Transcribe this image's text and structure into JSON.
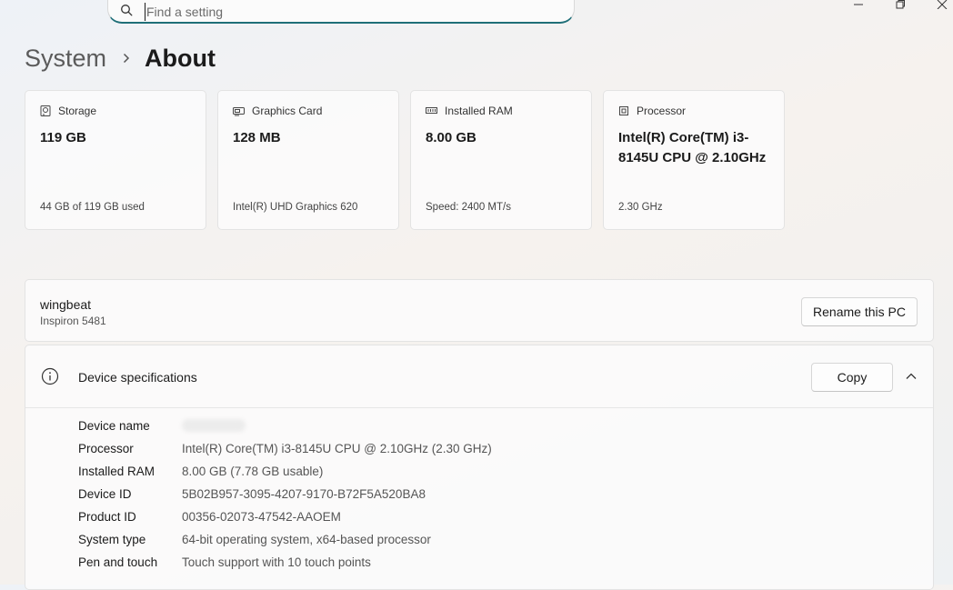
{
  "search": {
    "placeholder": "Find a setting"
  },
  "breadcrumb": {
    "parent": "System",
    "current": "About"
  },
  "cards": [
    {
      "title": "Storage",
      "value": "119 GB",
      "sub": "44 GB of 119 GB used",
      "icon": "storage-icon"
    },
    {
      "title": "Graphics Card",
      "value": "128 MB",
      "sub": "Intel(R) UHD Graphics 620",
      "icon": "graphics-card-icon"
    },
    {
      "title": "Installed RAM",
      "value": "8.00 GB",
      "sub": "Speed: 2400 MT/s",
      "icon": "ram-icon"
    },
    {
      "title": "Processor",
      "value": "Intel(R) Core(TM) i3-8145U CPU @ 2.10GHz",
      "sub": "2.30 GHz",
      "icon": "processor-icon"
    }
  ],
  "pc": {
    "name": "wingbeat",
    "model": "Inspiron 5481",
    "rename_label": "Rename this PC"
  },
  "device_specs": {
    "title": "Device specifications",
    "copy_label": "Copy",
    "rows": [
      {
        "label": "Device name",
        "value": ""
      },
      {
        "label": "Processor",
        "value": "Intel(R) Core(TM) i3-8145U CPU @ 2.10GHz (2.30 GHz)"
      },
      {
        "label": "Installed RAM",
        "value": "8.00 GB (7.78 GB usable)"
      },
      {
        "label": "Device ID",
        "value": "5B02B957-3095-4207-9170-B72F5A520BA8"
      },
      {
        "label": "Product ID",
        "value": "00356-02073-47542-AAOEM"
      },
      {
        "label": "System type",
        "value": "64-bit operating system, x64-based processor"
      },
      {
        "label": "Pen and touch",
        "value": "Touch support with 10 touch points"
      }
    ]
  },
  "colors": {
    "accent": "#1f6f78",
    "card_bg": "#fbfbfb",
    "border": "#e3e3e3"
  }
}
